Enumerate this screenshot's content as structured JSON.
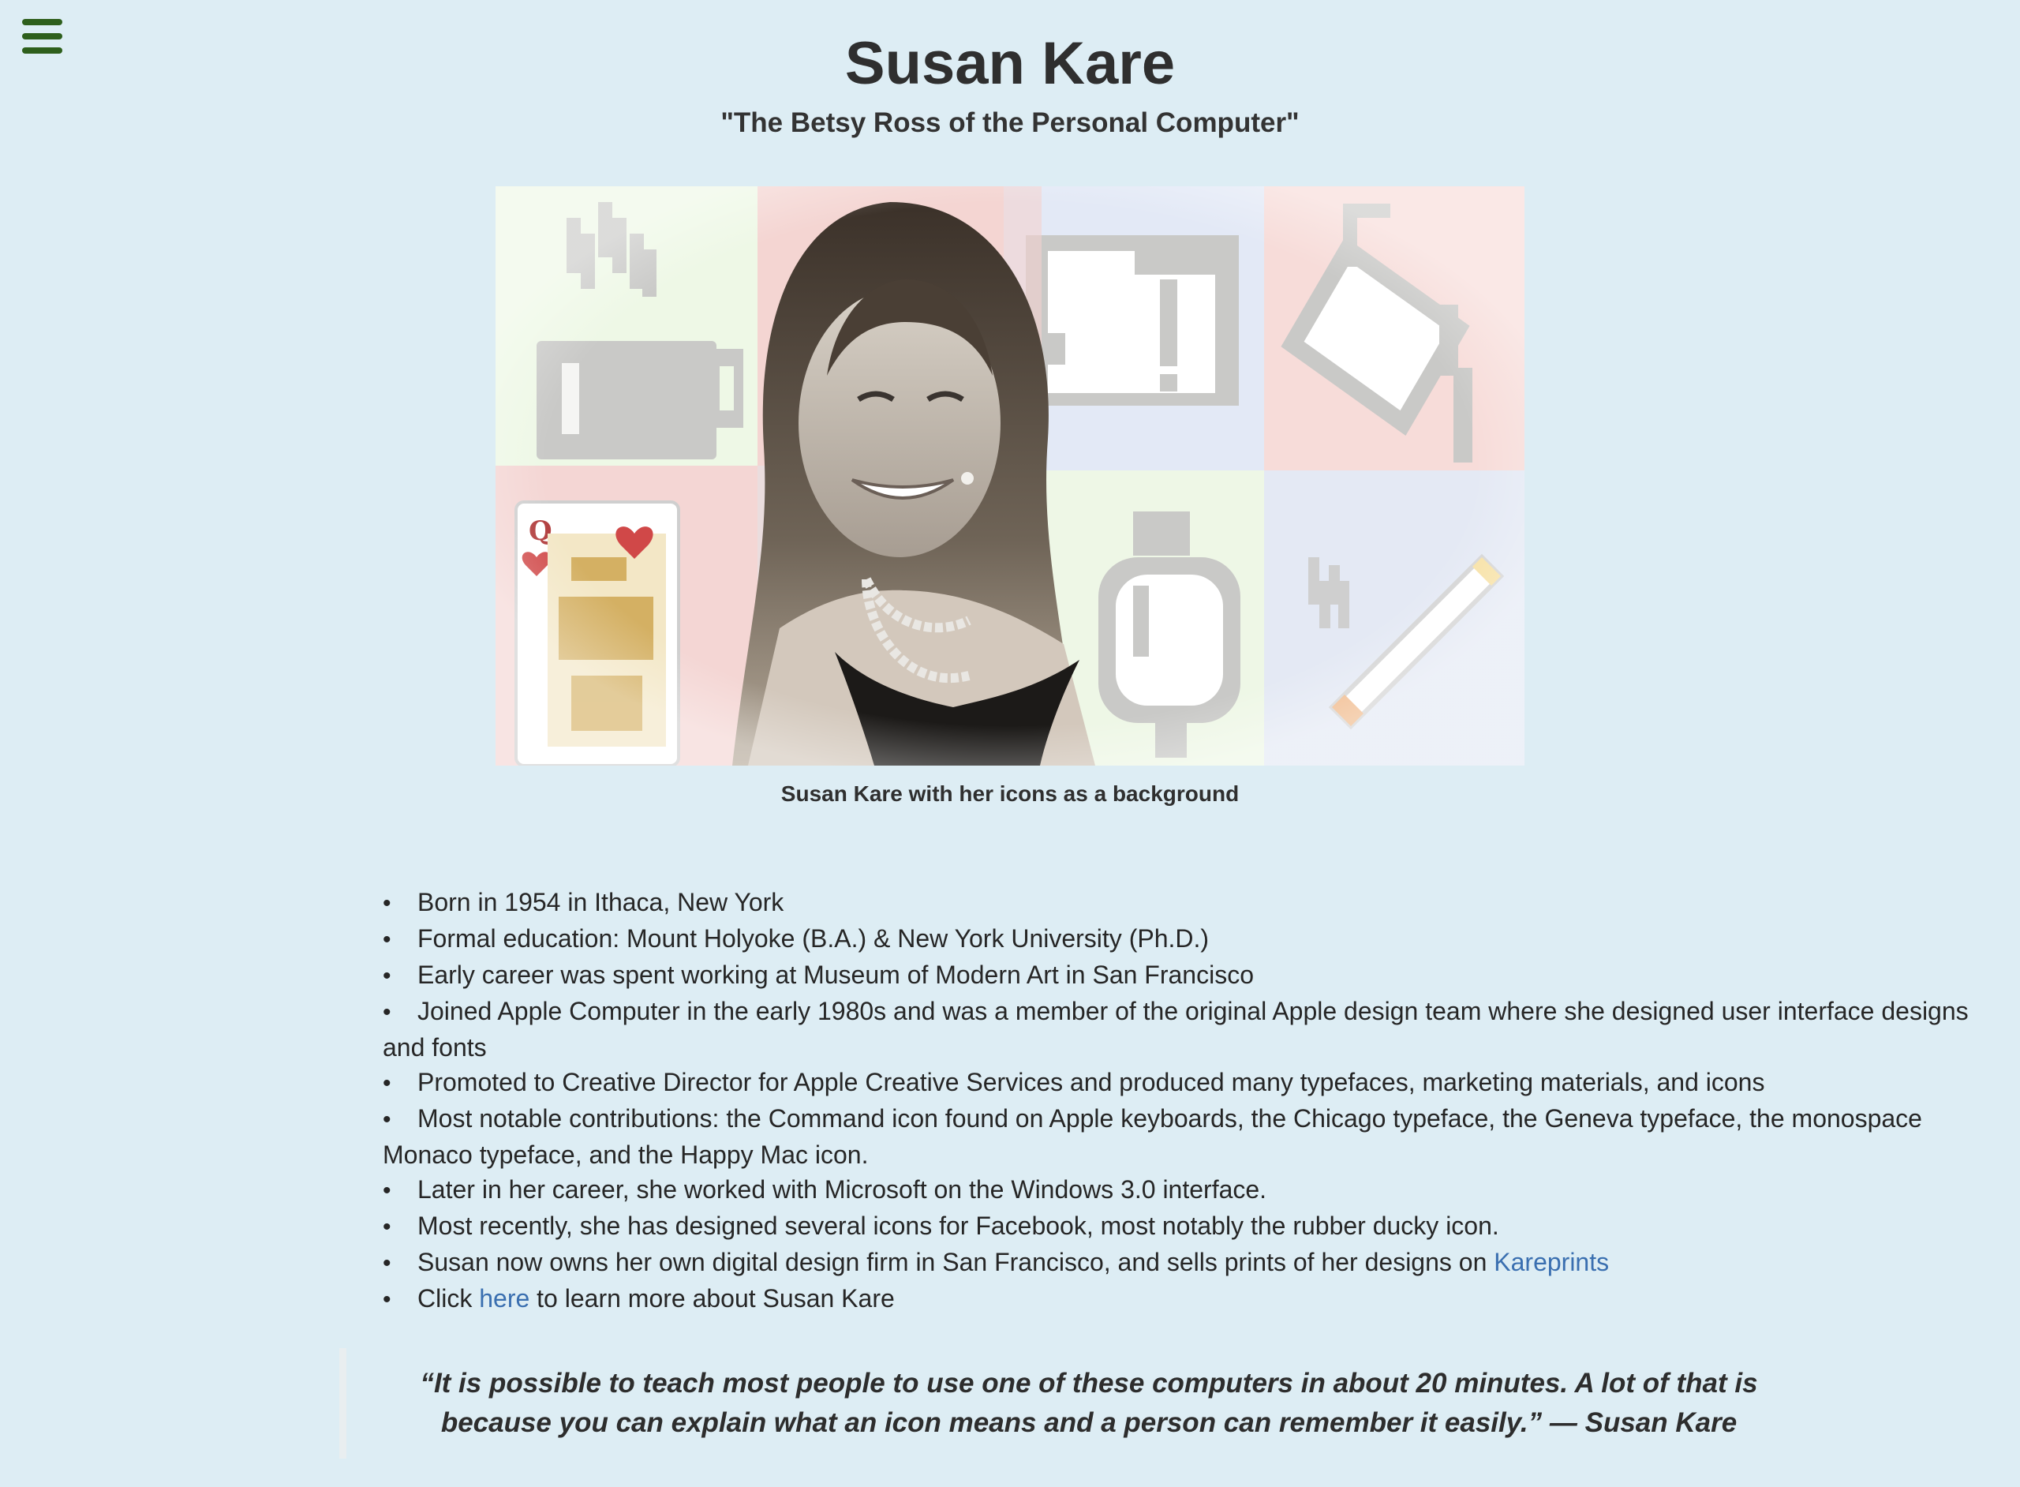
{
  "nav": {
    "menu_icon": "hamburger-menu-icon",
    "menu_color": "#2e5f1c"
  },
  "header": {
    "title": "Susan Kare",
    "subtitle": "\"The Betsy Ross of the Personal Computer\""
  },
  "figure": {
    "alt": "Susan Kare with her icons as a background",
    "caption": "Susan Kare with her icons as a background",
    "background_icons": [
      "coffee-cup-icon",
      "alert-icon",
      "paint-bucket-icon",
      "queen-of-hearts-card-icon",
      "stopwatch-icon",
      "cigarette-icon"
    ],
    "tile_colors": [
      "#eef8e6",
      "#f6d9d6",
      "#e3e9f6",
      "#f7dcd9",
      "#f4d6d4",
      "#eef7e6",
      "#e4e9f4"
    ]
  },
  "facts": [
    "Born in 1954 in Ithaca, New York",
    "Formal education: Mount Holyoke (B.A.) & New York University (Ph.D.)",
    "Early career was spent working at Museum of Modern Art in San Francisco",
    "Joined Apple Computer in the early 1980s and was a member of the original Apple design team where she designed user interface designs and fonts",
    "Promoted to Creative Director for Apple Creative Services and produced many typefaces, marketing materials, and icons",
    "Most notable contributions: the Command icon found on Apple keyboards, the Chicago typeface, the Geneva typeface, the monospace Monaco typeface, and the Happy Mac icon.",
    "Later in her career, she worked with Microsoft on the Windows 3.0 interface.",
    "Most recently, she has designed several icons for Facebook, most notably the rubber ducky icon."
  ],
  "kareprints_item": {
    "text_before": "Susan now owns her own digital design firm in San Francisco, and sells prints of her designs on ",
    "link_label": "Kareprints"
  },
  "learn_more_item": {
    "text_before": "Click ",
    "link_label": "here",
    "text_after": " to learn more about Susan Kare"
  },
  "quote": {
    "text": "“It is possible to teach most people to use one of these computers in about 20 minutes. A lot of that is because you can explain what an icon means and a person can remember it easily.” — Susan Kare"
  },
  "colors": {
    "background": "#ddedf4",
    "link": "#3a6fb0",
    "text": "#262626"
  }
}
